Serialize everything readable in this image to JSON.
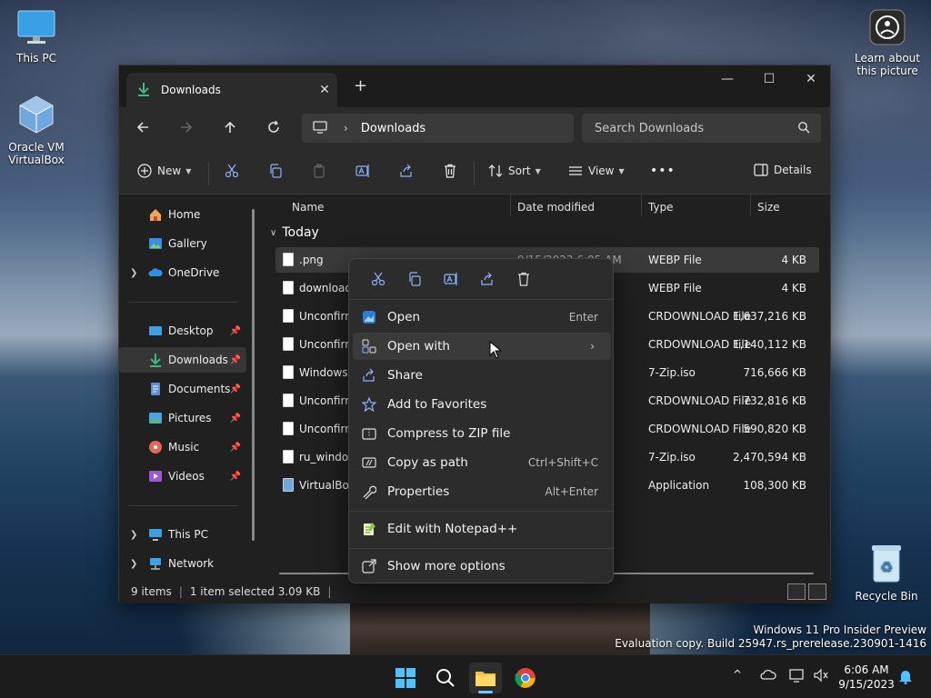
{
  "desktop": {
    "icons": [
      {
        "label": "This PC"
      },
      {
        "label": "Oracle VM VirtualBox"
      },
      {
        "label": "Learn about this picture"
      },
      {
        "label": "Recycle Bin"
      }
    ],
    "watermark": {
      "line1": "Windows 11 Pro Insider Preview",
      "line2": "Evaluation copy. Build 25947.rs_prerelease.230901-1416"
    }
  },
  "window": {
    "tab_title": "Downloads",
    "tab_close": "✕",
    "new_tab": "+",
    "controls": {
      "minimize": "—",
      "maximize": "☐",
      "close": "✕"
    },
    "address": {
      "crumb": "Downloads",
      "separator": "›"
    },
    "search": {
      "placeholder": "Search Downloads"
    },
    "toolbar": {
      "new_label": "New",
      "sort_label": "Sort",
      "view_label": "View",
      "more_label": "•••",
      "details_label": "Details"
    },
    "sidebar": {
      "items": [
        {
          "label": "Home"
        },
        {
          "label": "Gallery"
        },
        {
          "label": "OneDrive"
        },
        {
          "label": "Desktop"
        },
        {
          "label": "Downloads"
        },
        {
          "label": "Documents"
        },
        {
          "label": "Pictures"
        },
        {
          "label": "Music"
        },
        {
          "label": "Videos"
        },
        {
          "label": "This PC"
        },
        {
          "label": "Network"
        }
      ]
    },
    "columns": {
      "name": "Name",
      "date": "Date modified",
      "type": "Type",
      "size": "Size"
    },
    "group_label": "Today",
    "files": [
      {
        "name": ".png",
        "date": "9/15/2023 6:05 AM",
        "type": "WEBP File",
        "size": "4 KB"
      },
      {
        "name": "download",
        "date": "",
        "type": "WEBP File",
        "size": "4 KB"
      },
      {
        "name": "Unconfirm",
        "date": "",
        "type": "CRDOWNLOAD File",
        "size": "1,637,216 KB"
      },
      {
        "name": "Unconfirm",
        "date": "",
        "type": "CRDOWNLOAD File",
        "size": "1,140,112 KB"
      },
      {
        "name": "Windows.7",
        "date": "",
        "type": "7-Zip.iso",
        "size": "716,666 KB"
      },
      {
        "name": "Unconfirm",
        "date": "",
        "type": "CRDOWNLOAD File",
        "size": "732,816 KB"
      },
      {
        "name": "Unconfirm",
        "date": "",
        "type": "CRDOWNLOAD File",
        "size": "590,820 KB"
      },
      {
        "name": "ru_window",
        "date": "",
        "type": "7-Zip.iso",
        "size": "2,470,594 KB"
      },
      {
        "name": "VirtualBox",
        "date": "",
        "type": "Application",
        "size": "108,300 KB"
      }
    ],
    "status": {
      "count": "9 items",
      "selected": "1 item selected  3.09 KB",
      "sep": "|"
    }
  },
  "context_menu": {
    "items": [
      {
        "label": "Open",
        "accel": "Enter"
      },
      {
        "label": "Open with",
        "accel": "›"
      },
      {
        "label": "Share",
        "accel": ""
      },
      {
        "label": "Add to Favorites",
        "accel": ""
      },
      {
        "label": "Compress to ZIP file",
        "accel": ""
      },
      {
        "label": "Copy as path",
        "accel": "Ctrl+Shift+C"
      },
      {
        "label": "Properties",
        "accel": "Alt+Enter"
      },
      {
        "label": "Edit with Notepad++",
        "accel": ""
      },
      {
        "label": "Show more options",
        "accel": ""
      }
    ]
  },
  "taskbar": {
    "time": "6:06 AM",
    "date": "9/15/2023",
    "chevron": "^"
  },
  "colors": {
    "accent": "#60cdff",
    "folder": "#f5c242",
    "window_bg": "#202020"
  }
}
